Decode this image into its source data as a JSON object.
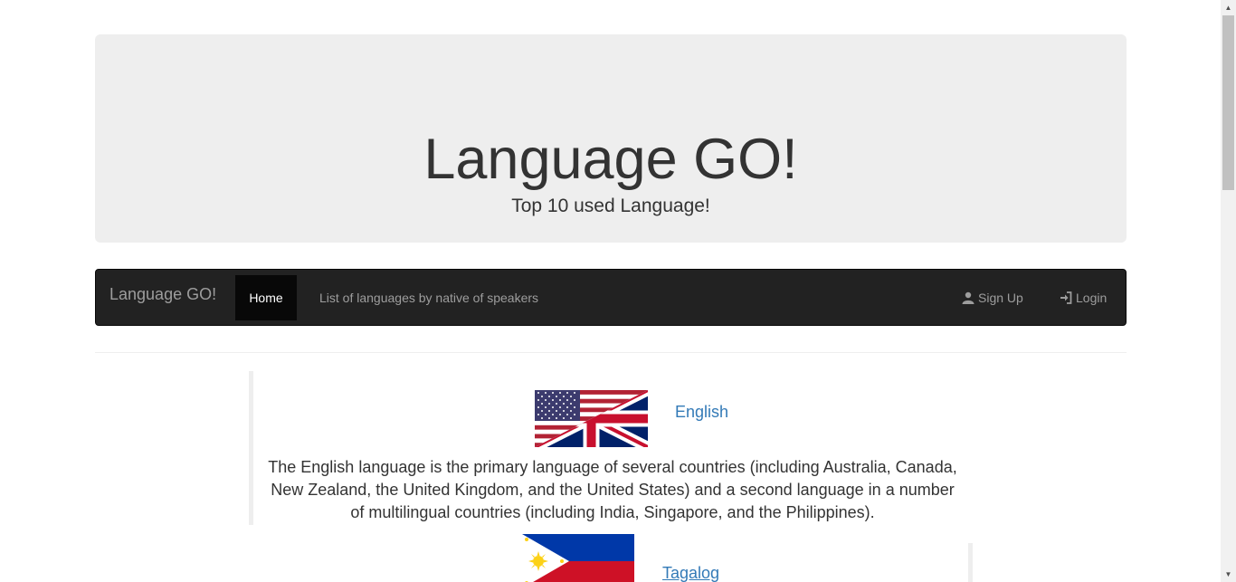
{
  "jumbotron": {
    "title": "Language GO!",
    "subtitle": "Top 10 used Language!"
  },
  "navbar": {
    "brand": "Language GO!",
    "home_label": "Home",
    "list_label": "List of languages by native of speakers",
    "signup_label": "Sign Up",
    "login_label": "Login"
  },
  "languages": [
    {
      "name": "English",
      "description": "The English language is the primary language of several countries (including Australia, Canada, New Zealand, the United Kingdom, and the United States) and a second language in a number of multilingual countries (including India, Singapore, and the Philippines).",
      "flag_icon": "us-uk-flag-icon"
    },
    {
      "name": "Tagalog",
      "flag_icon": "philippines-flag-icon"
    }
  ],
  "colors": {
    "jumbotron_bg": "#eeeeee",
    "navbar_bg": "#222222",
    "active_bg": "#080808",
    "link": "#337ab7",
    "nav_text": "#9d9d9d"
  }
}
